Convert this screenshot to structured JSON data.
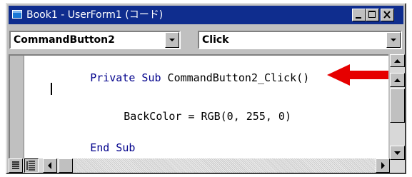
{
  "window": {
    "title": "Book1 - UserForm1 (コード)"
  },
  "object_combo": {
    "selected": "CommandButton2"
  },
  "procedure_combo": {
    "selected": "Click"
  },
  "code": {
    "lines": [
      {
        "keyword": "Private Sub",
        "rest": " CommandButton2_Click()"
      },
      {
        "keyword": "",
        "rest": "BackColor = RGB(0, 255, 0)"
      },
      {
        "keyword": "End Sub",
        "rest": ""
      }
    ]
  },
  "annotation": {
    "arrow_color": "#e60000"
  },
  "colors": {
    "titlebar": "#0f2d8e",
    "keyword": "#00008b"
  },
  "icons": {
    "app": "vba-editor-icon",
    "minimize": "minimize-icon",
    "maximize": "maximize-icon",
    "close": "close-icon",
    "dropdown": "chevron-down-icon",
    "procedure_view": "procedure-view-icon",
    "full_module_view": "full-module-view-icon"
  }
}
